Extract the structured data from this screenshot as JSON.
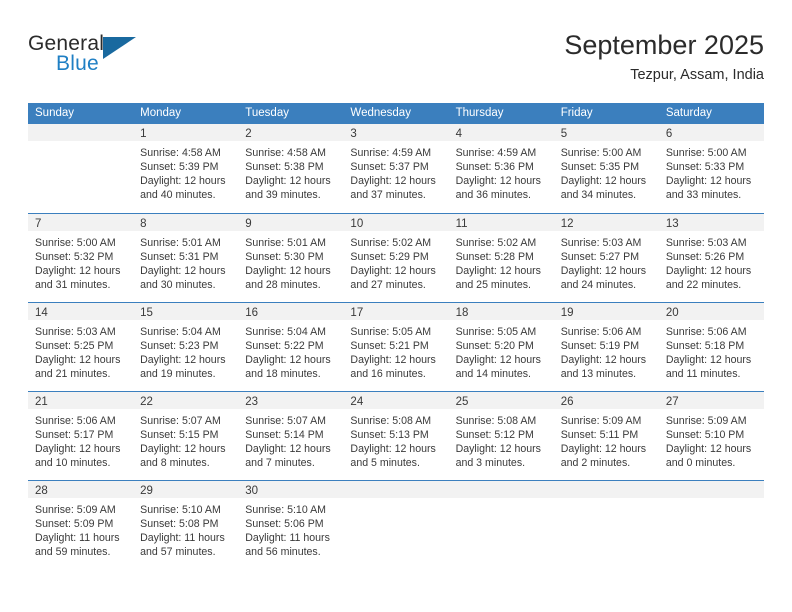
{
  "brand": {
    "name_top": "General",
    "name_bottom": "Blue",
    "accent_color": "#1f7fc4",
    "triangle_color": "#19699f"
  },
  "header": {
    "title": "September 2025",
    "subtitle": "Tezpur, Assam, India"
  },
  "calendar": {
    "header_color": "#3b7fbe",
    "day_band_color": "#f2f2f2",
    "weekday_headers": [
      "Sunday",
      "Monday",
      "Tuesday",
      "Wednesday",
      "Thursday",
      "Friday",
      "Saturday"
    ],
    "weeks": [
      [
        {
          "day": "",
          "lines": []
        },
        {
          "day": "1",
          "lines": [
            "Sunrise: 4:58 AM",
            "Sunset: 5:39 PM",
            "Daylight: 12 hours",
            "and 40 minutes."
          ]
        },
        {
          "day": "2",
          "lines": [
            "Sunrise: 4:58 AM",
            "Sunset: 5:38 PM",
            "Daylight: 12 hours",
            "and 39 minutes."
          ]
        },
        {
          "day": "3",
          "lines": [
            "Sunrise: 4:59 AM",
            "Sunset: 5:37 PM",
            "Daylight: 12 hours",
            "and 37 minutes."
          ]
        },
        {
          "day": "4",
          "lines": [
            "Sunrise: 4:59 AM",
            "Sunset: 5:36 PM",
            "Daylight: 12 hours",
            "and 36 minutes."
          ]
        },
        {
          "day": "5",
          "lines": [
            "Sunrise: 5:00 AM",
            "Sunset: 5:35 PM",
            "Daylight: 12 hours",
            "and 34 minutes."
          ]
        },
        {
          "day": "6",
          "lines": [
            "Sunrise: 5:00 AM",
            "Sunset: 5:33 PM",
            "Daylight: 12 hours",
            "and 33 minutes."
          ]
        }
      ],
      [
        {
          "day": "7",
          "lines": [
            "Sunrise: 5:00 AM",
            "Sunset: 5:32 PM",
            "Daylight: 12 hours",
            "and 31 minutes."
          ]
        },
        {
          "day": "8",
          "lines": [
            "Sunrise: 5:01 AM",
            "Sunset: 5:31 PM",
            "Daylight: 12 hours",
            "and 30 minutes."
          ]
        },
        {
          "day": "9",
          "lines": [
            "Sunrise: 5:01 AM",
            "Sunset: 5:30 PM",
            "Daylight: 12 hours",
            "and 28 minutes."
          ]
        },
        {
          "day": "10",
          "lines": [
            "Sunrise: 5:02 AM",
            "Sunset: 5:29 PM",
            "Daylight: 12 hours",
            "and 27 minutes."
          ]
        },
        {
          "day": "11",
          "lines": [
            "Sunrise: 5:02 AM",
            "Sunset: 5:28 PM",
            "Daylight: 12 hours",
            "and 25 minutes."
          ]
        },
        {
          "day": "12",
          "lines": [
            "Sunrise: 5:03 AM",
            "Sunset: 5:27 PM",
            "Daylight: 12 hours",
            "and 24 minutes."
          ]
        },
        {
          "day": "13",
          "lines": [
            "Sunrise: 5:03 AM",
            "Sunset: 5:26 PM",
            "Daylight: 12 hours",
            "and 22 minutes."
          ]
        }
      ],
      [
        {
          "day": "14",
          "lines": [
            "Sunrise: 5:03 AM",
            "Sunset: 5:25 PM",
            "Daylight: 12 hours",
            "and 21 minutes."
          ]
        },
        {
          "day": "15",
          "lines": [
            "Sunrise: 5:04 AM",
            "Sunset: 5:23 PM",
            "Daylight: 12 hours",
            "and 19 minutes."
          ]
        },
        {
          "day": "16",
          "lines": [
            "Sunrise: 5:04 AM",
            "Sunset: 5:22 PM",
            "Daylight: 12 hours",
            "and 18 minutes."
          ]
        },
        {
          "day": "17",
          "lines": [
            "Sunrise: 5:05 AM",
            "Sunset: 5:21 PM",
            "Daylight: 12 hours",
            "and 16 minutes."
          ]
        },
        {
          "day": "18",
          "lines": [
            "Sunrise: 5:05 AM",
            "Sunset: 5:20 PM",
            "Daylight: 12 hours",
            "and 14 minutes."
          ]
        },
        {
          "day": "19",
          "lines": [
            "Sunrise: 5:06 AM",
            "Sunset: 5:19 PM",
            "Daylight: 12 hours",
            "and 13 minutes."
          ]
        },
        {
          "day": "20",
          "lines": [
            "Sunrise: 5:06 AM",
            "Sunset: 5:18 PM",
            "Daylight: 12 hours",
            "and 11 minutes."
          ]
        }
      ],
      [
        {
          "day": "21",
          "lines": [
            "Sunrise: 5:06 AM",
            "Sunset: 5:17 PM",
            "Daylight: 12 hours",
            "and 10 minutes."
          ]
        },
        {
          "day": "22",
          "lines": [
            "Sunrise: 5:07 AM",
            "Sunset: 5:15 PM",
            "Daylight: 12 hours",
            "and 8 minutes."
          ]
        },
        {
          "day": "23",
          "lines": [
            "Sunrise: 5:07 AM",
            "Sunset: 5:14 PM",
            "Daylight: 12 hours",
            "and 7 minutes."
          ]
        },
        {
          "day": "24",
          "lines": [
            "Sunrise: 5:08 AM",
            "Sunset: 5:13 PM",
            "Daylight: 12 hours",
            "and 5 minutes."
          ]
        },
        {
          "day": "25",
          "lines": [
            "Sunrise: 5:08 AM",
            "Sunset: 5:12 PM",
            "Daylight: 12 hours",
            "and 3 minutes."
          ]
        },
        {
          "day": "26",
          "lines": [
            "Sunrise: 5:09 AM",
            "Sunset: 5:11 PM",
            "Daylight: 12 hours",
            "and 2 minutes."
          ]
        },
        {
          "day": "27",
          "lines": [
            "Sunrise: 5:09 AM",
            "Sunset: 5:10 PM",
            "Daylight: 12 hours",
            "and 0 minutes."
          ]
        }
      ],
      [
        {
          "day": "28",
          "lines": [
            "Sunrise: 5:09 AM",
            "Sunset: 5:09 PM",
            "Daylight: 11 hours",
            "and 59 minutes."
          ]
        },
        {
          "day": "29",
          "lines": [
            "Sunrise: 5:10 AM",
            "Sunset: 5:08 PM",
            "Daylight: 11 hours",
            "and 57 minutes."
          ]
        },
        {
          "day": "30",
          "lines": [
            "Sunrise: 5:10 AM",
            "Sunset: 5:06 PM",
            "Daylight: 11 hours",
            "and 56 minutes."
          ]
        },
        {
          "day": "",
          "lines": []
        },
        {
          "day": "",
          "lines": []
        },
        {
          "day": "",
          "lines": []
        },
        {
          "day": "",
          "lines": []
        }
      ]
    ]
  }
}
